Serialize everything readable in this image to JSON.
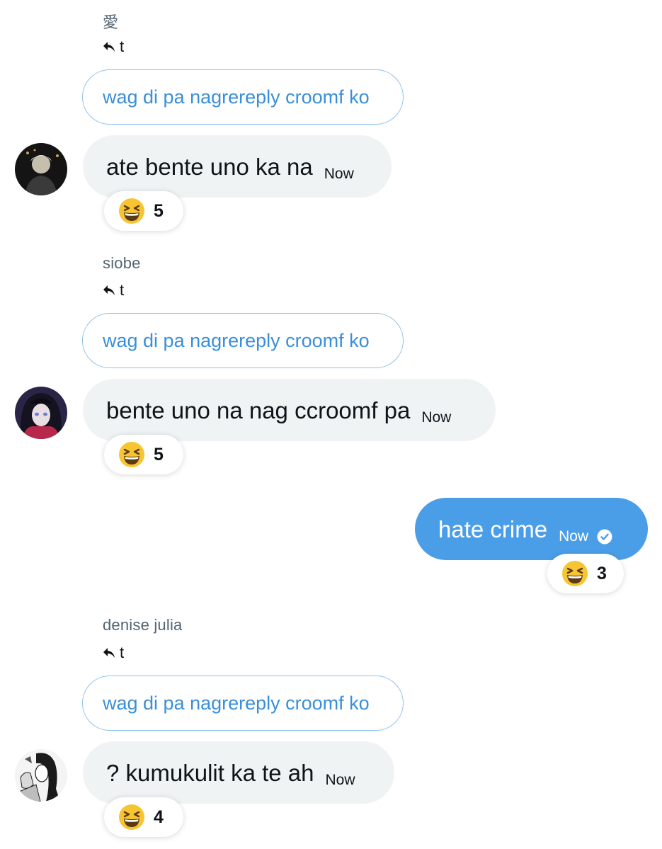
{
  "messages": [
    {
      "sender": "愛",
      "reply_to": "t",
      "quoted": "wag di pa nagrereply croomf ko",
      "text": "ate bente uno ka na",
      "time": "Now",
      "reaction": {
        "emoji": "grinning-squinting-face",
        "count": "5"
      }
    },
    {
      "sender": "siobe",
      "reply_to": "t",
      "quoted": "wag di pa nagrereply croomf ko",
      "text": "bente uno na nag ccroomf pa",
      "time": "Now",
      "reaction": {
        "emoji": "grinning-squinting-face",
        "count": "5"
      }
    },
    {
      "outgoing": true,
      "text": "hate crime",
      "time": "Now",
      "status": "seen-check",
      "reaction": {
        "emoji": "grinning-squinting-face",
        "count": "3"
      }
    },
    {
      "sender": "denise julia",
      "reply_to": "t",
      "quoted": "wag di pa nagrereply croomf ko",
      "text": "? kumukulit ka te ah",
      "time": "Now",
      "reaction": {
        "emoji": "grinning-squinting-face",
        "count": "4"
      }
    }
  ],
  "colors": {
    "incoming_bubble": "#eff3f4",
    "outgoing_bubble": "#4a9ee8",
    "quoted_text": "#3a8fd9",
    "quoted_border": "#8ec1ec",
    "sender_name": "#536471"
  }
}
